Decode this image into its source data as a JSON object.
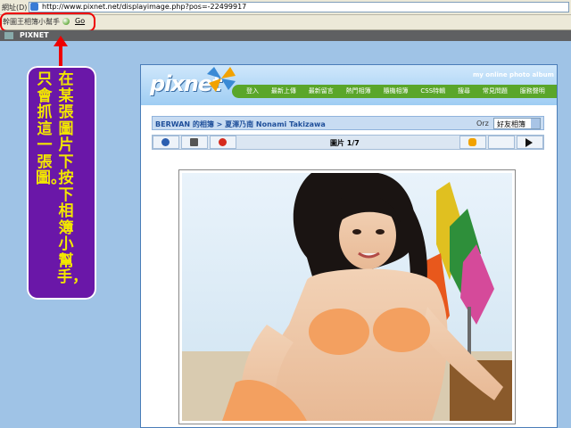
{
  "browser": {
    "address_label": "網址(D)",
    "url": "http://www.pixnet.net/displayimage.php?pos=-22499917"
  },
  "toolbar": {
    "helper_label": "幹圖王相簿小幫手",
    "go_label": "Go"
  },
  "pixnet_bar": {
    "label": "PIXNET"
  },
  "annotation": {
    "column1": "在某張圖片下按下相簿小幫手，",
    "column2": "只會抓這一張圖。",
    "color": "#f2e600",
    "background": "#6a17a8",
    "highlight_color": "#ee0000"
  },
  "site": {
    "logo": "pixnet",
    "tagline": "my online photo album",
    "nav": [
      "登入",
      "最新上傳",
      "最新留言",
      "熱門相簿",
      "隨機相簿",
      "CSS特輯",
      "搜尋",
      "常見問題",
      "服務聲明"
    ],
    "accent": "#5aa62a"
  },
  "album": {
    "breadcrumb": "BERWAN 的相簿 > 夏澤乃南 Nonami Takizawa",
    "orz": "Orz",
    "select_value": "好友相簿",
    "photo_counter": "圖片 1/7"
  },
  "icons": {
    "info": "info-icon",
    "slideshow": "slideshow-icon",
    "report": "report-icon",
    "hand": "hand-icon",
    "next": "next-icon"
  }
}
